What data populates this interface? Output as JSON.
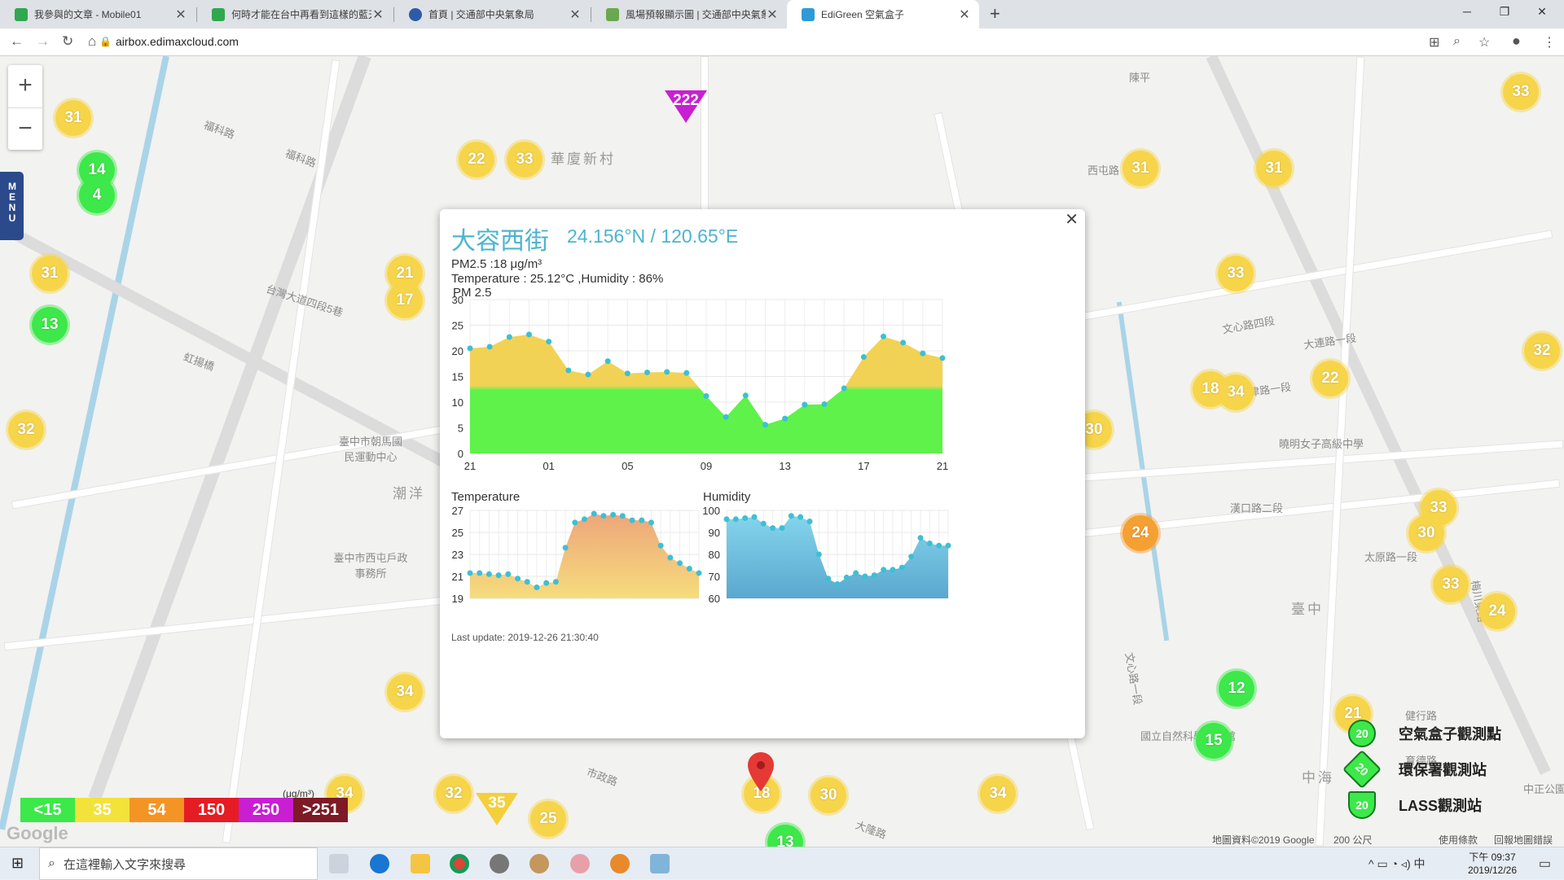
{
  "browser": {
    "tabs": [
      {
        "title": "我參與的文章 - Mobile01",
        "color": "#2fa84f"
      },
      {
        "title": "何時才能在台中再看到這樣的藍天",
        "color": "#2fa84f"
      },
      {
        "title": "首頁 | 交通部中央氣象局",
        "color": "#2d5ba8"
      },
      {
        "title": "風場預報顯示圖 | 交通部中央氣象",
        "color": "#6aa84f"
      },
      {
        "title": "EdiGreen 空氣盒子",
        "color": "#2f9bd4"
      }
    ],
    "url": "airbox.edimaxcloud.com"
  },
  "map": {
    "menu_label": "MENU",
    "place_labels": [
      "陳平",
      "華廈新村",
      "福科路",
      "福科路",
      "西屯路",
      "潮洋",
      "臺中市朝馬國民運動中心",
      "臺中市西屯戶政事務所",
      "台灣大道四段5巷",
      "虹揚橋",
      "文心路四段",
      "天津路一段",
      "曉明女子高級中學",
      "大連路一段",
      "漢口路二段",
      "太原路一段",
      "臺中",
      "中正公園",
      "國立自然科學博物館",
      "中海",
      "市政路",
      "文心路一段",
      "大隆路",
      "健行路",
      "育德路",
      "梅川東路"
    ],
    "markers_yellow": [
      "31",
      "33",
      "31",
      "31",
      "33",
      "22",
      "33",
      "21",
      "17",
      "31",
      "32",
      "34",
      "33",
      "32",
      "30",
      "24",
      "34",
      "33",
      "30",
      "34",
      "25",
      "18",
      "30",
      "32",
      "18",
      "34",
      "22",
      "21"
    ],
    "markers_green": [
      "14",
      "4",
      "13",
      "12",
      "15",
      "13"
    ],
    "markers_orange": [
      "24"
    ],
    "triangles": [
      "222",
      "35"
    ]
  },
  "popup": {
    "title": "大容西街",
    "coords": "24.156°N / 120.65°E",
    "pm": "PM2.5 :18 μg/m³",
    "temp_humidity": "Temperature : 25.12°C ,Humidity : 86%",
    "chart_title": "PM 2.5",
    "temp_title": "Temperature",
    "hum_title": "Humidity",
    "last_update": "Last update: 2019-12-26 21:30:40"
  },
  "legend": {
    "unit": "(μg/m³)",
    "items": [
      {
        "label": "<15",
        "color": "#3de84a"
      },
      {
        "label": "35",
        "color": "#f3e23a"
      },
      {
        "label": "54",
        "color": "#f39425"
      },
      {
        "label": "150",
        "color": "#e51c23"
      },
      {
        "label": "250",
        "color": "#c81fd2"
      },
      {
        "label": ">251",
        "color": "#7d1a26"
      }
    ]
  },
  "stations": [
    {
      "value": "20",
      "label": "空氣盒子觀測點"
    },
    {
      "value": "20",
      "label": "環保署觀測站"
    },
    {
      "value": "20",
      "label": "LASS觀測站"
    }
  ],
  "attribution": {
    "data": "地圖資料©2019 Google",
    "scale": "200 公尺",
    "terms": "使用條款",
    "report": "回報地圖錯誤"
  },
  "taskbar": {
    "search_placeholder": "在這裡輸入文字來搜尋",
    "time": "下午 09:37",
    "date": "2019/12/26"
  },
  "chart_data": [
    {
      "type": "area",
      "title": "PM 2.5",
      "x_ticks": [
        "21",
        "01",
        "05",
        "09",
        "13",
        "17",
        "21"
      ],
      "ylim": [
        0,
        30
      ],
      "y_ticks": [
        0,
        5,
        10,
        15,
        20,
        25,
        30
      ],
      "series": [
        {
          "values": [
            20.5,
            20.8,
            22.7,
            23.2,
            21.8,
            16.2,
            15.4,
            18,
            15.6,
            15.8,
            15.9,
            15.7,
            11.2,
            7.1,
            11.3,
            5.6,
            6.8,
            9.5,
            9.6,
            12.7,
            18.8,
            22.8,
            21.6,
            19.5,
            18.6
          ]
        }
      ]
    },
    {
      "type": "area",
      "title": "Temperature",
      "ylim": [
        19,
        27
      ],
      "y_ticks": [
        19,
        21,
        23,
        25,
        27
      ],
      "series": [
        {
          "values": [
            21.3,
            21.3,
            21.2,
            21.1,
            21.2,
            20.8,
            20.5,
            20,
            20.4,
            20.5,
            23.6,
            25.9,
            26.2,
            26.7,
            26.5,
            26.6,
            26.5,
            26.1,
            26.1,
            25.9,
            23.8,
            22.7,
            22.2,
            21.7,
            21.3
          ]
        }
      ]
    },
    {
      "type": "area",
      "title": "Humidity",
      "ylim": [
        60,
        100
      ],
      "y_ticks": [
        60,
        70,
        80,
        90,
        100
      ],
      "series": [
        {
          "values": [
            96,
            96,
            96.5,
            97,
            94,
            92,
            92,
            97.5,
            97,
            95,
            80,
            69,
            66.5,
            69.5,
            71.5,
            70,
            70.5,
            73,
            73,
            74,
            79,
            87.5,
            85,
            84,
            84
          ]
        }
      ]
    }
  ]
}
